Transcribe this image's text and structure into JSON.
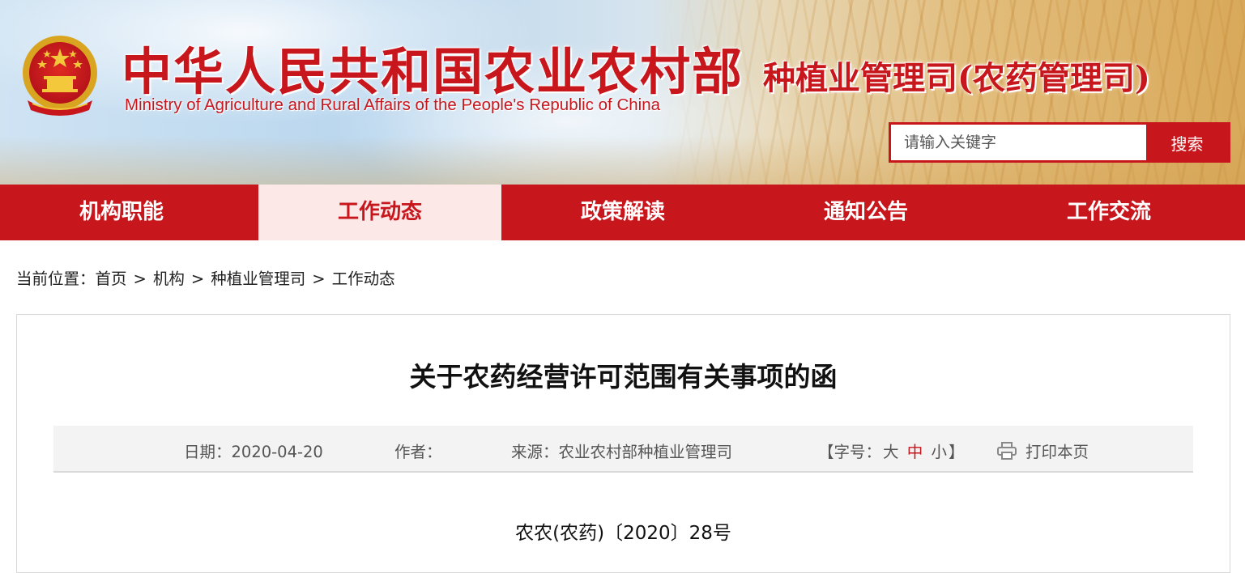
{
  "header": {
    "site_title_cn": "中华人民共和国农业农村部",
    "site_title_en": "Ministry of Agriculture and Rural Affairs of the People's Republic of China",
    "dept_title": "种植业管理司(农药管理司)",
    "emblem_icon": "national-emblem-icon",
    "search": {
      "placeholder": "请输入关键字",
      "value": "",
      "button_label": "搜索"
    }
  },
  "nav": {
    "items": [
      {
        "label": "机构职能",
        "active": false
      },
      {
        "label": "工作动态",
        "active": true
      },
      {
        "label": "政策解读",
        "active": false
      },
      {
        "label": "通知公告",
        "active": false
      },
      {
        "label": "工作交流",
        "active": false
      }
    ]
  },
  "breadcrumb": {
    "prefix": "当前位置：",
    "items": [
      "首页",
      "机构",
      "种植业管理司",
      "工作动态"
    ],
    "separator": ">"
  },
  "article": {
    "title": "关于农药经营许可范围有关事项的函",
    "meta": {
      "date": "日期：2020-04-20",
      "author": "作者：",
      "source": "来源：农业农村部种植业管理司",
      "fontsize_prefix": "【字号：",
      "fontsize_large": "大",
      "fontsize_medium": "中",
      "fontsize_small": "小",
      "fontsize_suffix": "】",
      "print_label": "打印本页",
      "print_icon": "printer-icon"
    },
    "doc_number": "农农(农药)〔2020〕28号"
  },
  "colors": {
    "brand_red": "#c8161d",
    "nav_active_bg": "#fde8e8",
    "meta_bar_bg": "#f3f3f3"
  }
}
